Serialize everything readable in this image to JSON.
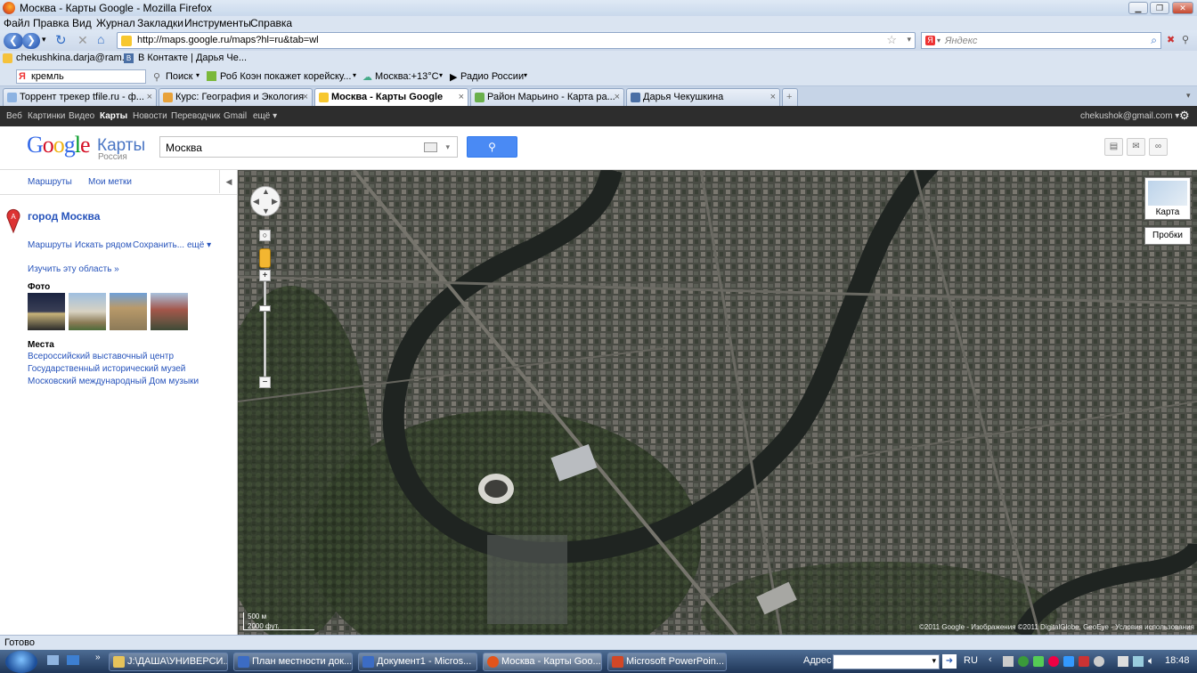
{
  "window": {
    "title": "Москва - Карты Google - Mozilla Firefox"
  },
  "menu": [
    "Файл",
    "Правка",
    "Вид",
    "Журнал",
    "Закладки",
    "Инструменты",
    "Справка"
  ],
  "nav": {
    "url": "http://maps.google.ru/maps?hl=ru&tab=wl",
    "search_placeholder": "Яндекс"
  },
  "bookmarks": [
    "chekushkina.darja@ram...",
    "В Контакте | Дарья Че..."
  ],
  "yandex_bar": {
    "query": "кремль",
    "search_label": "Поиск",
    "rss": "Роб Коэн покажет корейску...",
    "weather": "Москва:+13°C",
    "radio": "Радио России"
  },
  "tabs": [
    {
      "label": "Торрент трекер tfile.ru - ф...",
      "active": false
    },
    {
      "label": "Курс: География и Экология",
      "active": false
    },
    {
      "label": "Москва - Карты Google",
      "active": true
    },
    {
      "label": "Район Марьино - Карта ра...",
      "active": false
    },
    {
      "label": "Дарья Чекушкина",
      "active": false
    }
  ],
  "gbar": {
    "links": [
      "Веб",
      "Картинки",
      "Видео",
      "Карты",
      "Новости",
      "Переводчик",
      "Gmail",
      "ещё ▾"
    ],
    "selected": "Карты",
    "account": "chekushok@gmail.com ▾"
  },
  "header": {
    "logo": "Google",
    "product": "Карты",
    "country": "Россия",
    "query": "Москва"
  },
  "sidebar": {
    "top_links": [
      "Маршруты",
      "Мои метки"
    ],
    "place_title": "город Москва",
    "actions": [
      "Маршруты",
      "Искать рядом",
      "Сохранить...",
      "ещё ▾"
    ],
    "explore": "Изучить эту область »",
    "photos_heading": "Фото",
    "places_heading": "Места",
    "places": [
      "Всероссийский выставочный центр",
      "Государственный исторический музей",
      "Московский международный Дом музыки"
    ]
  },
  "map": {
    "layer_button": "Карта",
    "traffic_button": "Пробки",
    "scale_m": "500 м",
    "scale_ft": "2000 фут.",
    "copyright": "©2011 Google - Изображения ©2011 DigitalGlobe, GeoEye - Условия использования"
  },
  "status": "Готово",
  "taskbar": {
    "items": [
      {
        "label": "J:\\ДАША\\УНИВЕРСИ...",
        "active": false
      },
      {
        "label": "План местности док...",
        "active": false
      },
      {
        "label": "Документ1 - Micros...",
        "active": false
      },
      {
        "label": "Москва - Карты Goo...",
        "active": true
      },
      {
        "label": "Microsoft PowerPoin...",
        "active": false
      }
    ],
    "address_label": "Адрес",
    "lang": "RU",
    "time": "18:48"
  },
  "colors": {
    "link": "#2653bb",
    "gbar": "#2d2d2d",
    "search_button": "#4a8af4"
  }
}
